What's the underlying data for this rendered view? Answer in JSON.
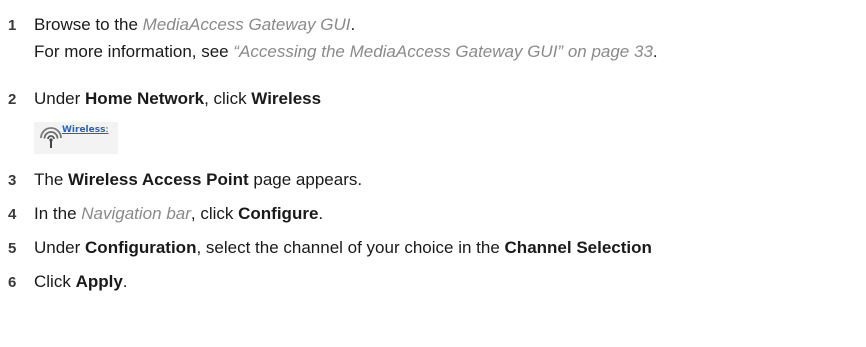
{
  "steps": [
    {
      "number": "1",
      "pre": "Browse to the ",
      "link": "MediaAccess Gateway GUI",
      "post": ".",
      "note_pre": "For more information, see ",
      "note_link": "“Accessing the MediaAccess Gateway GUI” on page 33",
      "note_post": "."
    },
    {
      "number": "2",
      "pre": "Under ",
      "bold1": "Home Network",
      "mid": ", click ",
      "bold2": "Wireless"
    },
    {
      "number": "3",
      "pre": "The ",
      "bold1": "Wireless Access Point",
      "post": " page appears."
    },
    {
      "number": "4",
      "pre": "In the ",
      "link": "Navigation bar",
      "mid": ", click ",
      "bold1": "Configure",
      "post": "."
    },
    {
      "number": "5",
      "pre": "Under ",
      "bold1": "Configuration",
      "mid": ", select the channel of your choice in the ",
      "bold2": "Channel Selection"
    },
    {
      "number": "6",
      "pre": "Click ",
      "bold1": "Apply",
      "post": "."
    }
  ],
  "screenshot": {
    "icon": "wireless-antenna-icon",
    "link_label": "Wireless",
    "colon": ":",
    "link_color": "#1f63c9"
  }
}
